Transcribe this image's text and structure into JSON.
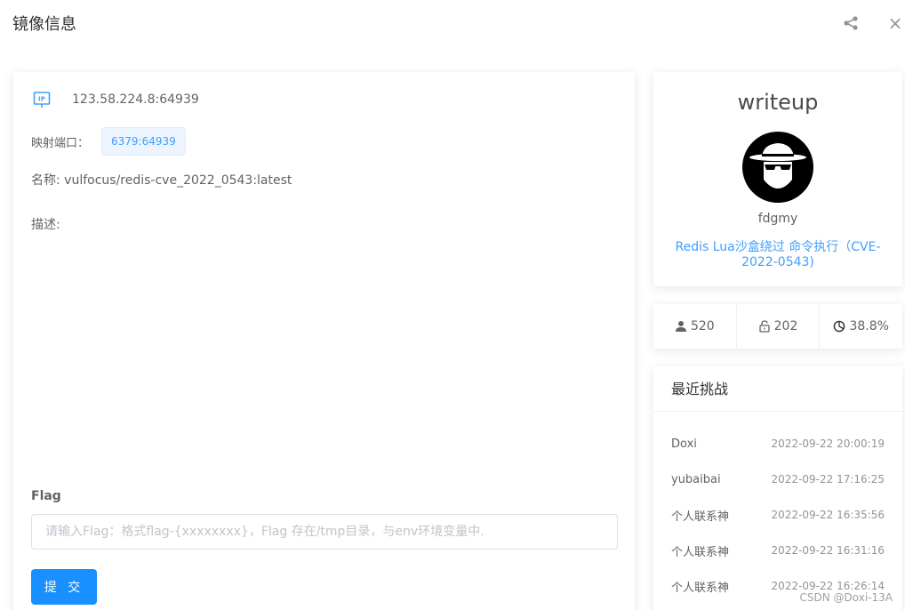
{
  "dialog": {
    "title": "镜像信息"
  },
  "left": {
    "ip": "123.58.224.8:64939",
    "port_label": "映射端口：",
    "port_value": "6379:64939",
    "name_text": "名称: vulfocus/redis-cve_2022_0543:latest",
    "desc_text": "描述:",
    "flag_label": "Flag",
    "flag_placeholder": "请输入Flag：格式flag-{xxxxxxxx}，Flag 存在/tmp目录，与env环境变量中.",
    "submit_label": "提 交"
  },
  "writeup": {
    "title": "writeup",
    "user": "fdgmy",
    "vuln_title": "Redis Lua沙盒绕过 命令执行（CVE-2022-0543)"
  },
  "stats": {
    "users": "520",
    "solved": "202",
    "rate": "38.8%"
  },
  "recent": {
    "title": "最近挑战",
    "items": [
      {
        "user": "Doxi",
        "time": "2022-09-22 20:00:19"
      },
      {
        "user": "yubaibai",
        "time": "2022-09-22 17:16:25"
      },
      {
        "user": "个人联系神",
        "time": "2022-09-22 16:35:56"
      },
      {
        "user": "个人联系神",
        "time": "2022-09-22 16:31:16"
      },
      {
        "user": "个人联系神",
        "time": "2022-09-22 16:26:14"
      }
    ]
  },
  "watermark": "CSDN @Doxi-13A",
  "colors": {
    "accent": "#409eff",
    "button": "#1890ff",
    "tag_bg": "#ecf5ff"
  },
  "icons": {
    "ip": "ip-icon",
    "share": "share-icon",
    "close": "close-icon",
    "user": "user-icon",
    "lock": "unlock-icon",
    "rate": "pie-icon"
  }
}
